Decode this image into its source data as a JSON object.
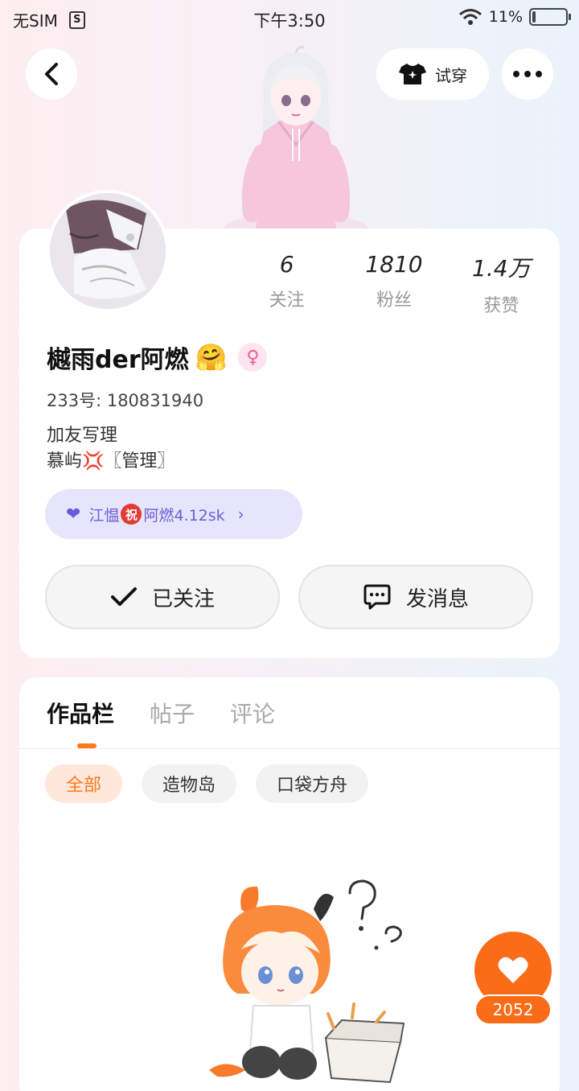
{
  "status_bar": {
    "carrier": "无SIM",
    "sim_icon": "S",
    "time": "下午3:50",
    "battery": "11%",
    "battery_level": 0.11,
    "wifi_icon": "wifi-icon"
  },
  "top_bar": {
    "back_icon": "back-arrow-icon",
    "try_on_label": "试穿",
    "try_on_icon": "tshirt-icon",
    "more_icon": "more-dots-icon"
  },
  "profile": {
    "stats": [
      {
        "value": "6",
        "label": "关注"
      },
      {
        "value": "1810",
        "label": "粉丝"
      },
      {
        "value": "1.4万",
        "label": "获赞"
      }
    ],
    "username": "樾雨der阿燃",
    "username_emoji": "🤗",
    "gender_symbol": "♀",
    "uid": "233号: 180831940",
    "bio_line1": "加友写理",
    "bio_line2": "慕屿💢〖管理〗",
    "cp_badge": {
      "name1": "江愠",
      "zhu": "祝",
      "name2": "阿燃4.12sk"
    },
    "follow_button": "已关注",
    "message_button": "发消息"
  },
  "works": {
    "tabs": [
      "作品栏",
      "帖子",
      "评论"
    ],
    "active_tab": 0,
    "chips": [
      "全部",
      "造物岛",
      "口袋方舟"
    ],
    "active_chip": 0
  },
  "like_fab": {
    "count": "2052"
  },
  "colors": {
    "accent": "#fd7a1c",
    "cp_purple": "#6c5ed6"
  }
}
